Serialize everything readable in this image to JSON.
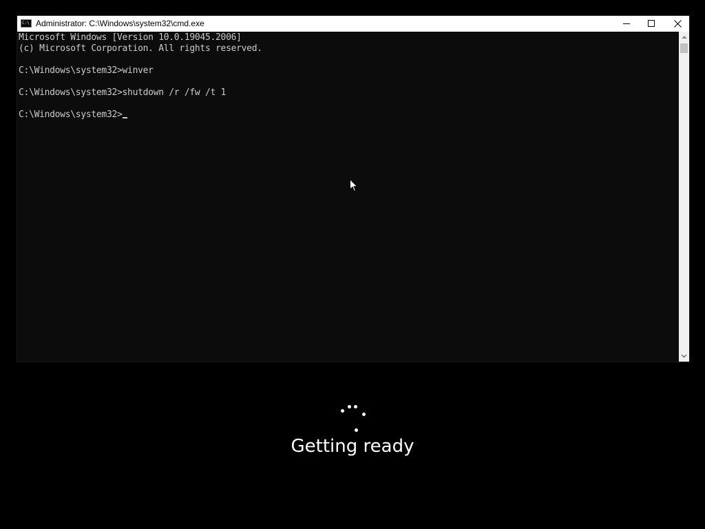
{
  "window": {
    "title": "Administrator: C:\\Windows\\system32\\cmd.exe",
    "icon": "cmd-icon",
    "icon_glyph": "C:\\",
    "controls": {
      "minimize": "minimize-icon",
      "maximize": "maximize-icon",
      "close": "close-icon"
    }
  },
  "console": {
    "lines": [
      "Microsoft Windows [Version 10.0.19045.2006]",
      "(c) Microsoft Corporation. All rights reserved.",
      "",
      "C:\\Windows\\system32>winver",
      "",
      "C:\\Windows\\system32>shutdown /r /fw /t 1",
      "",
      "C:\\Windows\\system32>"
    ],
    "text_color": "#cccccc",
    "background_color": "#0c0c0c"
  },
  "scrollbar": {
    "up_icon": "chevron-up-icon",
    "down_icon": "chevron-down-icon"
  },
  "overlay": {
    "status": "Getting ready",
    "spinner_icon": "loading-spinner-icon"
  },
  "pointer": {
    "icon": "mouse-pointer-icon"
  }
}
